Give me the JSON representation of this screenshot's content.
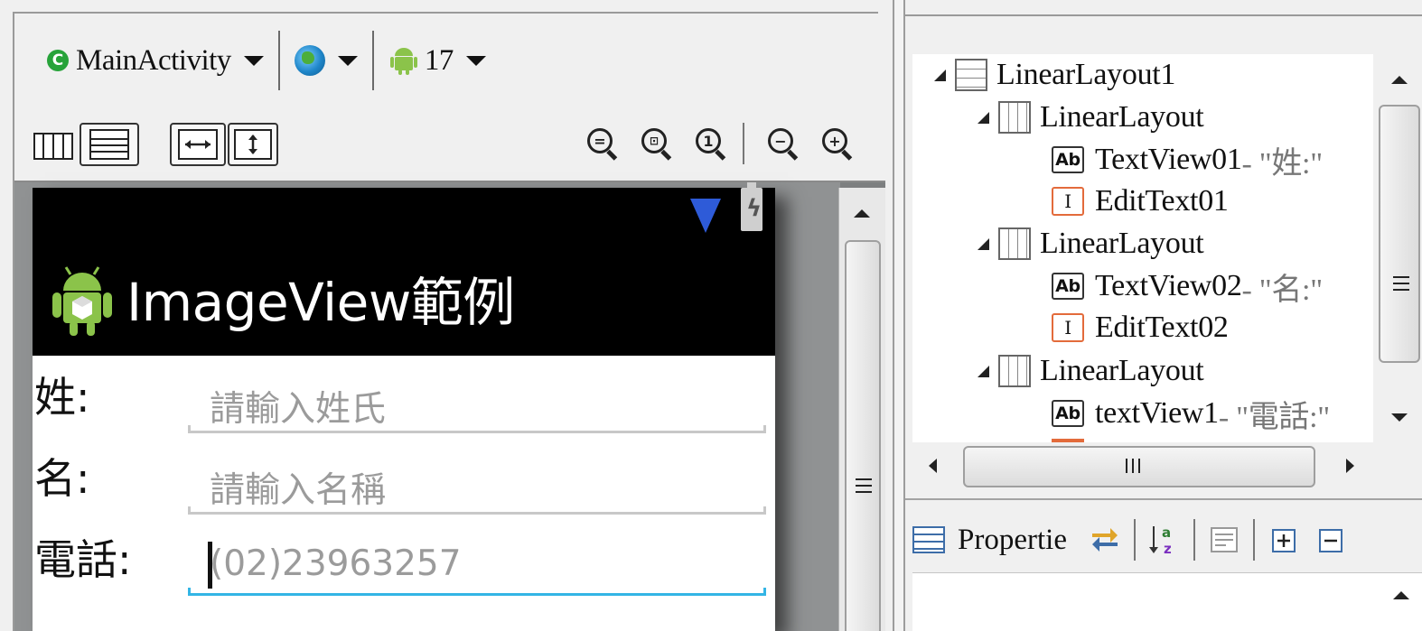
{
  "toolbar": {
    "activity": "MainActivity",
    "api_level": "17"
  },
  "device": {
    "app_title": "ImageView範例"
  },
  "form": {
    "rows": [
      {
        "label": "姓:",
        "value": "請輸入姓氏",
        "is_placeholder": true
      },
      {
        "label": "名:",
        "value": "請輸入名稱",
        "is_placeholder": true
      },
      {
        "label": "電話:",
        "value": "(02)23963257",
        "is_placeholder": true
      }
    ]
  },
  "outline": {
    "items": [
      {
        "label": "LinearLayout1",
        "suffix": ""
      },
      {
        "label": "LinearLayout",
        "suffix": ""
      },
      {
        "label": "TextView01",
        "suffix": " - \"姓:\""
      },
      {
        "label": "EditText01",
        "suffix": ""
      },
      {
        "label": "LinearLayout",
        "suffix": ""
      },
      {
        "label": "TextView02",
        "suffix": " - \"名:\""
      },
      {
        "label": "EditText02",
        "suffix": ""
      },
      {
        "label": "LinearLayout",
        "suffix": ""
      },
      {
        "label": "textView1",
        "suffix": " - \"電話:\""
      }
    ]
  },
  "icons": {
    "activity": "class-c-icon",
    "ab": "Ab",
    "edit": "I"
  },
  "properties": {
    "title": "Propertie"
  },
  "colors": {
    "focus_underline": "#33b5e5",
    "edittext_icon": "#e36b3b"
  }
}
